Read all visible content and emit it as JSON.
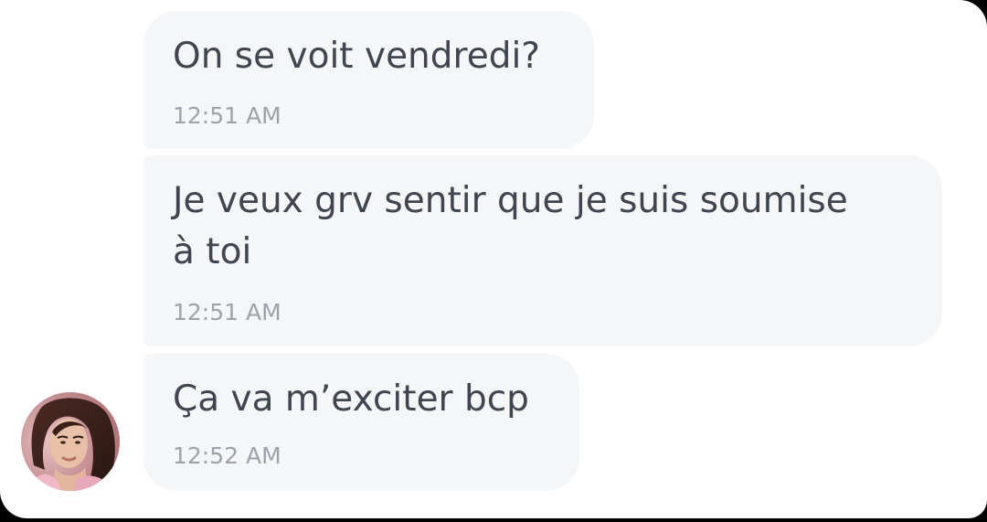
{
  "conversation": {
    "messages": [
      {
        "text": "On se voit vendredi?",
        "time": "12:51 AM"
      },
      {
        "text": "Je veux grv sentir que je suis soumise\nà toi",
        "time": "12:51 AM"
      },
      {
        "text": "Ça va m’exciter bcp",
        "time": "12:52 AM"
      }
    ]
  },
  "colors": {
    "panel_background": "#ffffff",
    "bubble_background": "#f5f6f8",
    "message_text": "#3f4650",
    "timestamp_text": "#9ca3aa"
  },
  "icons": {
    "avatar": "contact-profile-photo"
  }
}
